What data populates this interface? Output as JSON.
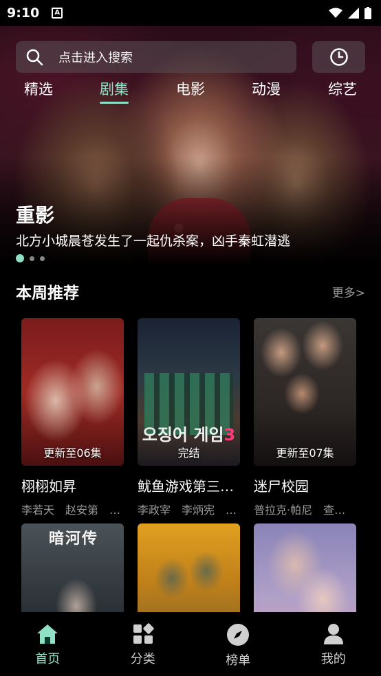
{
  "status_bar": {
    "time": "9:10",
    "notification_icon": "a-icon"
  },
  "search": {
    "placeholder": "点击进入搜索"
  },
  "tabs": [
    {
      "label": "精选",
      "active": false
    },
    {
      "label": "剧集",
      "active": true
    },
    {
      "label": "电影",
      "active": false
    },
    {
      "label": "动漫",
      "active": false
    },
    {
      "label": "综艺",
      "active": false
    }
  ],
  "hero": {
    "title": "重影",
    "subtitle": "北方小城晨苍发生了一起仇杀案，凶手秦虹潜逃",
    "slide_count": 3,
    "active_slide": 1
  },
  "weekly": {
    "title": "本周推荐",
    "more": "更多>",
    "items": [
      {
        "name": "栩栩如昇",
        "cast": "李若天　赵安第　…",
        "badge": "更新至06集"
      },
      {
        "name": "鱿鱼游戏第三…",
        "cast": "李政宰　李炳宪　…",
        "badge": "完结",
        "poster_logo": "오징어 게임",
        "poster_logo_tail": "3"
      },
      {
        "name": "迷尸校园",
        "cast": "普拉克·帕尼　查…",
        "badge": "更新至07集"
      },
      {
        "name": "",
        "cast": "",
        "badge": "",
        "poster_title": "暗河传"
      },
      {
        "name": "",
        "cast": "",
        "badge": ""
      },
      {
        "name": "",
        "cast": "",
        "badge": ""
      }
    ]
  },
  "bottom_nav": [
    {
      "label": "首页",
      "icon": "home-icon",
      "active": true
    },
    {
      "label": "分类",
      "icon": "category-icon",
      "active": false
    },
    {
      "label": "榜单",
      "icon": "compass-icon",
      "active": false
    },
    {
      "label": "我的",
      "icon": "user-icon",
      "active": false
    }
  ],
  "colors": {
    "accent": "#8fe0c6",
    "muted": "#9a9a9a",
    "background": "#000000"
  }
}
